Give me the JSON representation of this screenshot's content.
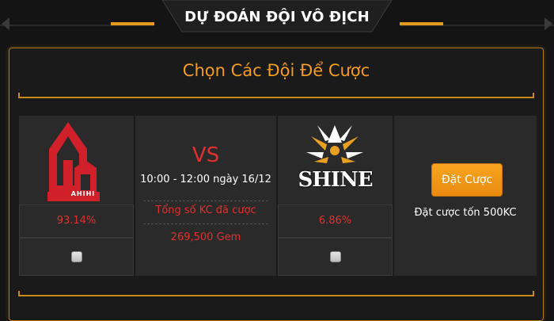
{
  "header": {
    "title": "DỰ ĐOÁN ĐỘI VÔ ĐỊCH"
  },
  "panel": {
    "title": "Chọn Các Đội Để Cược"
  },
  "match": {
    "team_a": {
      "logo_text": "AHIHI",
      "percent": "93.14%",
      "selected": false
    },
    "team_b": {
      "logo_text": "SHINE",
      "percent": "6.86%",
      "selected": false
    },
    "vs": "VS",
    "time": "10:00 - 12:00 ngày 16/12",
    "total_label": "Tổng số KC đã cược",
    "total_value": "269,500 Gem"
  },
  "bet": {
    "button_label": "Đặt Cược",
    "cost_text": "Đặt cược tốn 500KC"
  },
  "colors": {
    "accent": "#f39c1f",
    "red": "#e03030",
    "gold_line": "#c88a1c",
    "button": "#f39c1f"
  }
}
